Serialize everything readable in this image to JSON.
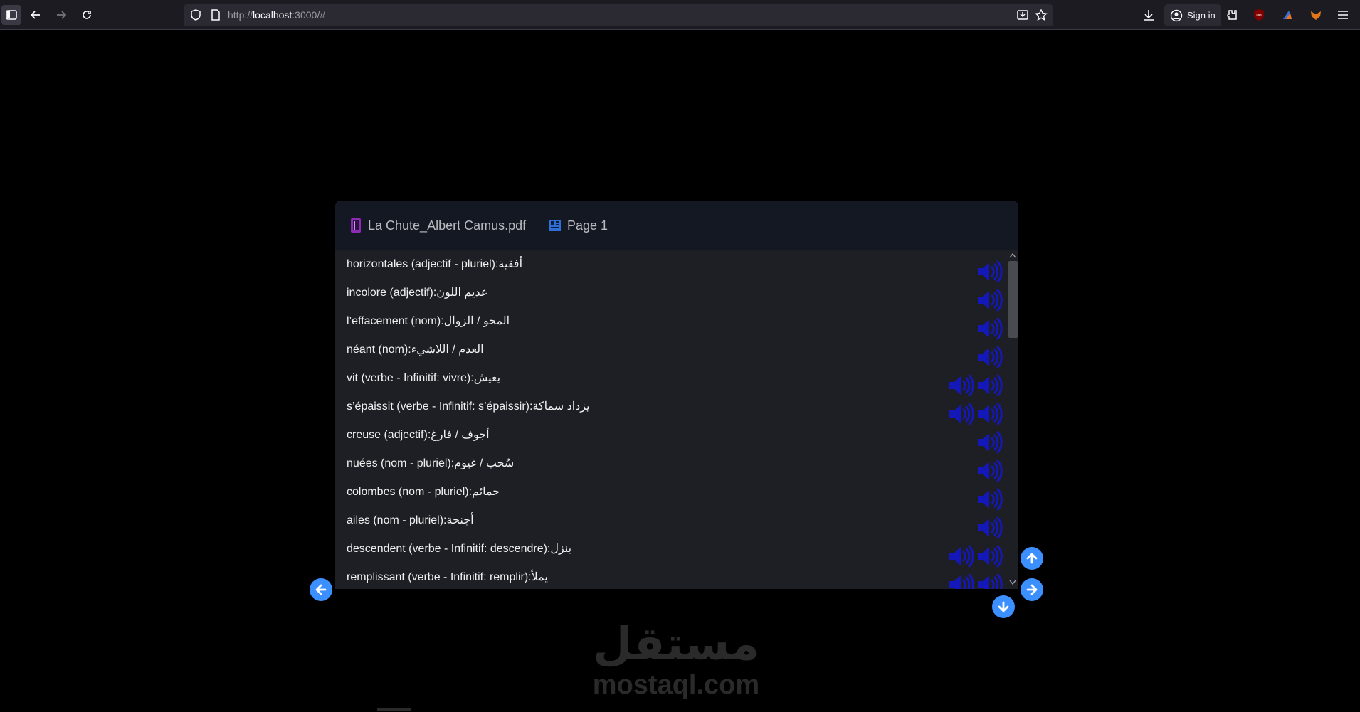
{
  "browser": {
    "url_scheme": "http://",
    "url_host": "localhost",
    "url_rest": ":3000/#",
    "signin_label": "Sign in",
    "icons": [
      "sidebar-icon",
      "back-arrow-icon",
      "forward-arrow-icon",
      "reload-icon",
      "shield-icon",
      "page-icon",
      "reader-view-icon",
      "star-icon",
      "download-icon",
      "account-icon",
      "extensions-icon",
      "ublock-icon",
      "extension-icon",
      "fox-extension-icon",
      "menu-icon"
    ]
  },
  "panel": {
    "file_name": "La Chute_Albert Camus.pdf",
    "page_label": "Page 1",
    "colors": {
      "speaker": "#1518b8",
      "nav_button": "#3b8fff"
    }
  },
  "vocab": [
    {
      "text": "horizontales (adjectif - pluriel):أفقية",
      "speakers": 1
    },
    {
      "text": "incolore (adjectif):عديم اللون",
      "speakers": 1
    },
    {
      "text": "l’effacement (nom):المحو / الزوال",
      "speakers": 1
    },
    {
      "text": "néant (nom):العدم / اللاشيء",
      "speakers": 1
    },
    {
      "text": "vit (verbe - Infinitif: vivre):يعيش",
      "speakers": 2
    },
    {
      "text": "s’épaissit (verbe - Infinitif: s’épaissir):يزداد سماكة",
      "speakers": 2
    },
    {
      "text": "creuse (adjectif):أجوف / فارغ",
      "speakers": 1
    },
    {
      "text": "nuées (nom - pluriel):سُحب / غيوم",
      "speakers": 1
    },
    {
      "text": "colombes (nom - pluriel):حمائم",
      "speakers": 1
    },
    {
      "text": "ailes (nom - pluriel):أجنحة",
      "speakers": 1
    },
    {
      "text": "descendent (verbe - Infinitif: descendre):ينزل",
      "speakers": 2
    },
    {
      "text": "remplissant (verbe - Infinitif: remplir):يملأ",
      "speakers": 2
    }
  ],
  "watermark": {
    "arabic": "مستقل",
    "latin": "mostaql.com"
  }
}
